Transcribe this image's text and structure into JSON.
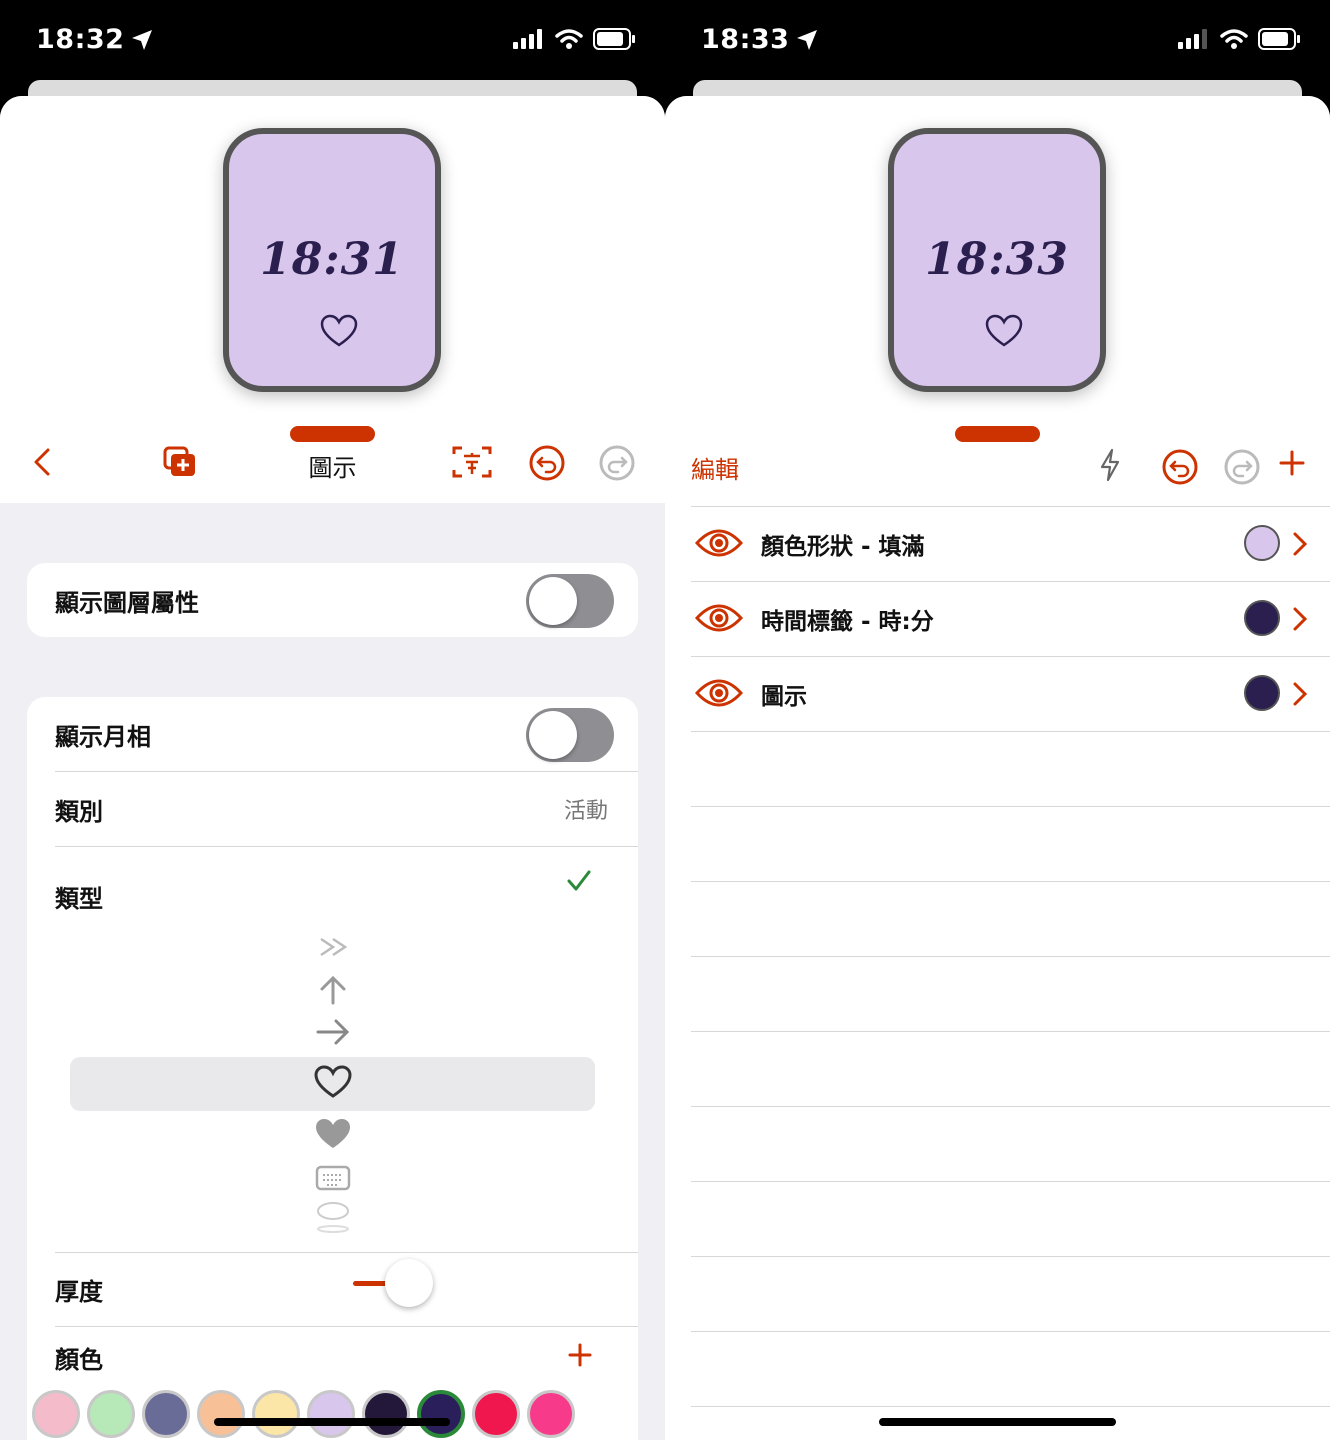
{
  "left": {
    "status_time": "18:32",
    "watch_time": "18:31",
    "title": "圖示",
    "settings": {
      "show_layer_props": "顯示圖層屬性",
      "show_moon": "顯示月相",
      "category_label": "類別",
      "category_value": "活動",
      "type_label": "類型",
      "thickness_label": "厚度",
      "color_label": "顏色"
    },
    "swatch_colors": [
      "#f4bccb",
      "#b6e8b8",
      "#6a6c98",
      "#f8c096",
      "#fbe6a8",
      "#d9c6ec",
      "#24183a",
      "#2a1f5a",
      "#f0164e",
      "#f83a8a"
    ]
  },
  "right": {
    "status_time": "18:33",
    "watch_time": "18:33",
    "edit_label": "編輯",
    "layers": [
      {
        "name": "顏色形狀 - 填滿",
        "color": "#d9c6ec"
      },
      {
        "name": "時間標籤 - 時:分",
        "color": "#2a1f4e"
      },
      {
        "name": "圖示",
        "color": "#2a1f4e"
      }
    ]
  },
  "accent": "#cc3300"
}
